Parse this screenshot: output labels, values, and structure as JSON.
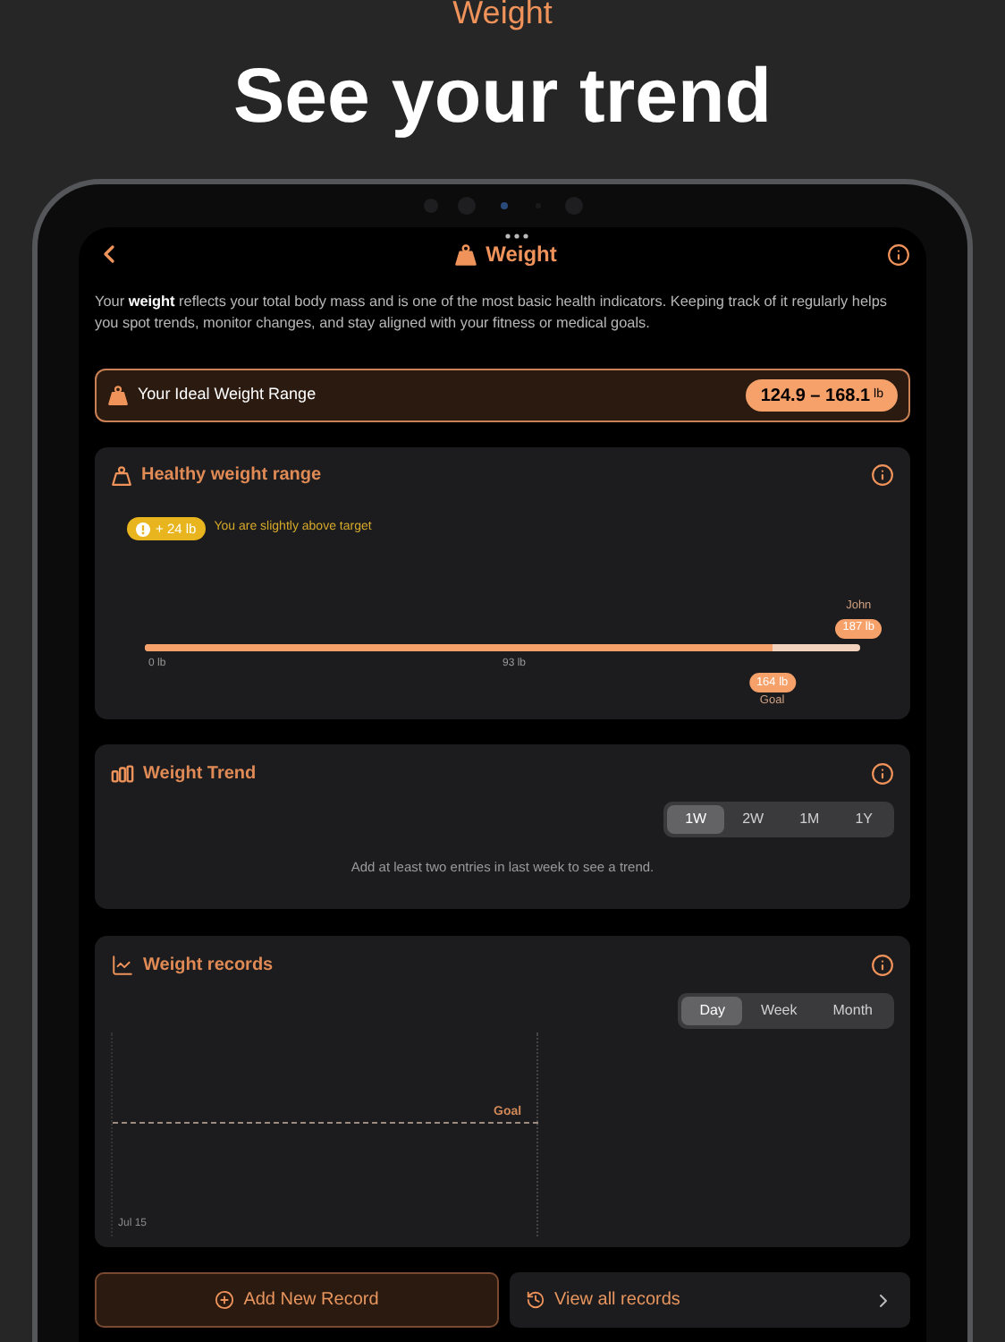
{
  "header": {
    "eyebrow": "Weight",
    "headline": "See your trend"
  },
  "nav": {
    "title": "Weight"
  },
  "intro": "Your **weight** reflects your total body mass and is one of the most basic health indicators. Keeping track of it regularly helps you spot trends, monitor changes, and stay aligned with your fitness or medical goals.",
  "ideal_range": {
    "label": "Your Ideal Weight Range",
    "value": "124.9 – 168.1",
    "unit": "lb"
  },
  "healthy_range": {
    "title": "Healthy weight range",
    "badge": "+ 24 lb",
    "status": "You are slightly above target",
    "person": "John",
    "current": "187 lb",
    "ticks": [
      "0 lb",
      "93 lb"
    ],
    "goal_value": "164 lb",
    "goal_label": "Goal",
    "level": 0.877
  },
  "trend": {
    "title": "Weight Trend",
    "periods": [
      {
        "label": "1W",
        "selected": true
      },
      {
        "label": "2W",
        "selected": false
      },
      {
        "label": "1M",
        "selected": false
      },
      {
        "label": "1Y",
        "selected": false
      }
    ],
    "message": "Add at least two entries in last week to see a trend."
  },
  "records": {
    "title": "Weight records",
    "periods": [
      {
        "label": "Day",
        "selected": true
      },
      {
        "label": "Week",
        "selected": false
      },
      {
        "label": "Month",
        "selected": false
      }
    ],
    "goal_label": "Goal",
    "x_label": "Jul 15"
  },
  "actions": [
    {
      "label": "Add New Record",
      "kind": "primary"
    },
    {
      "label": "View all records",
      "kind": "secondary"
    }
  ]
}
